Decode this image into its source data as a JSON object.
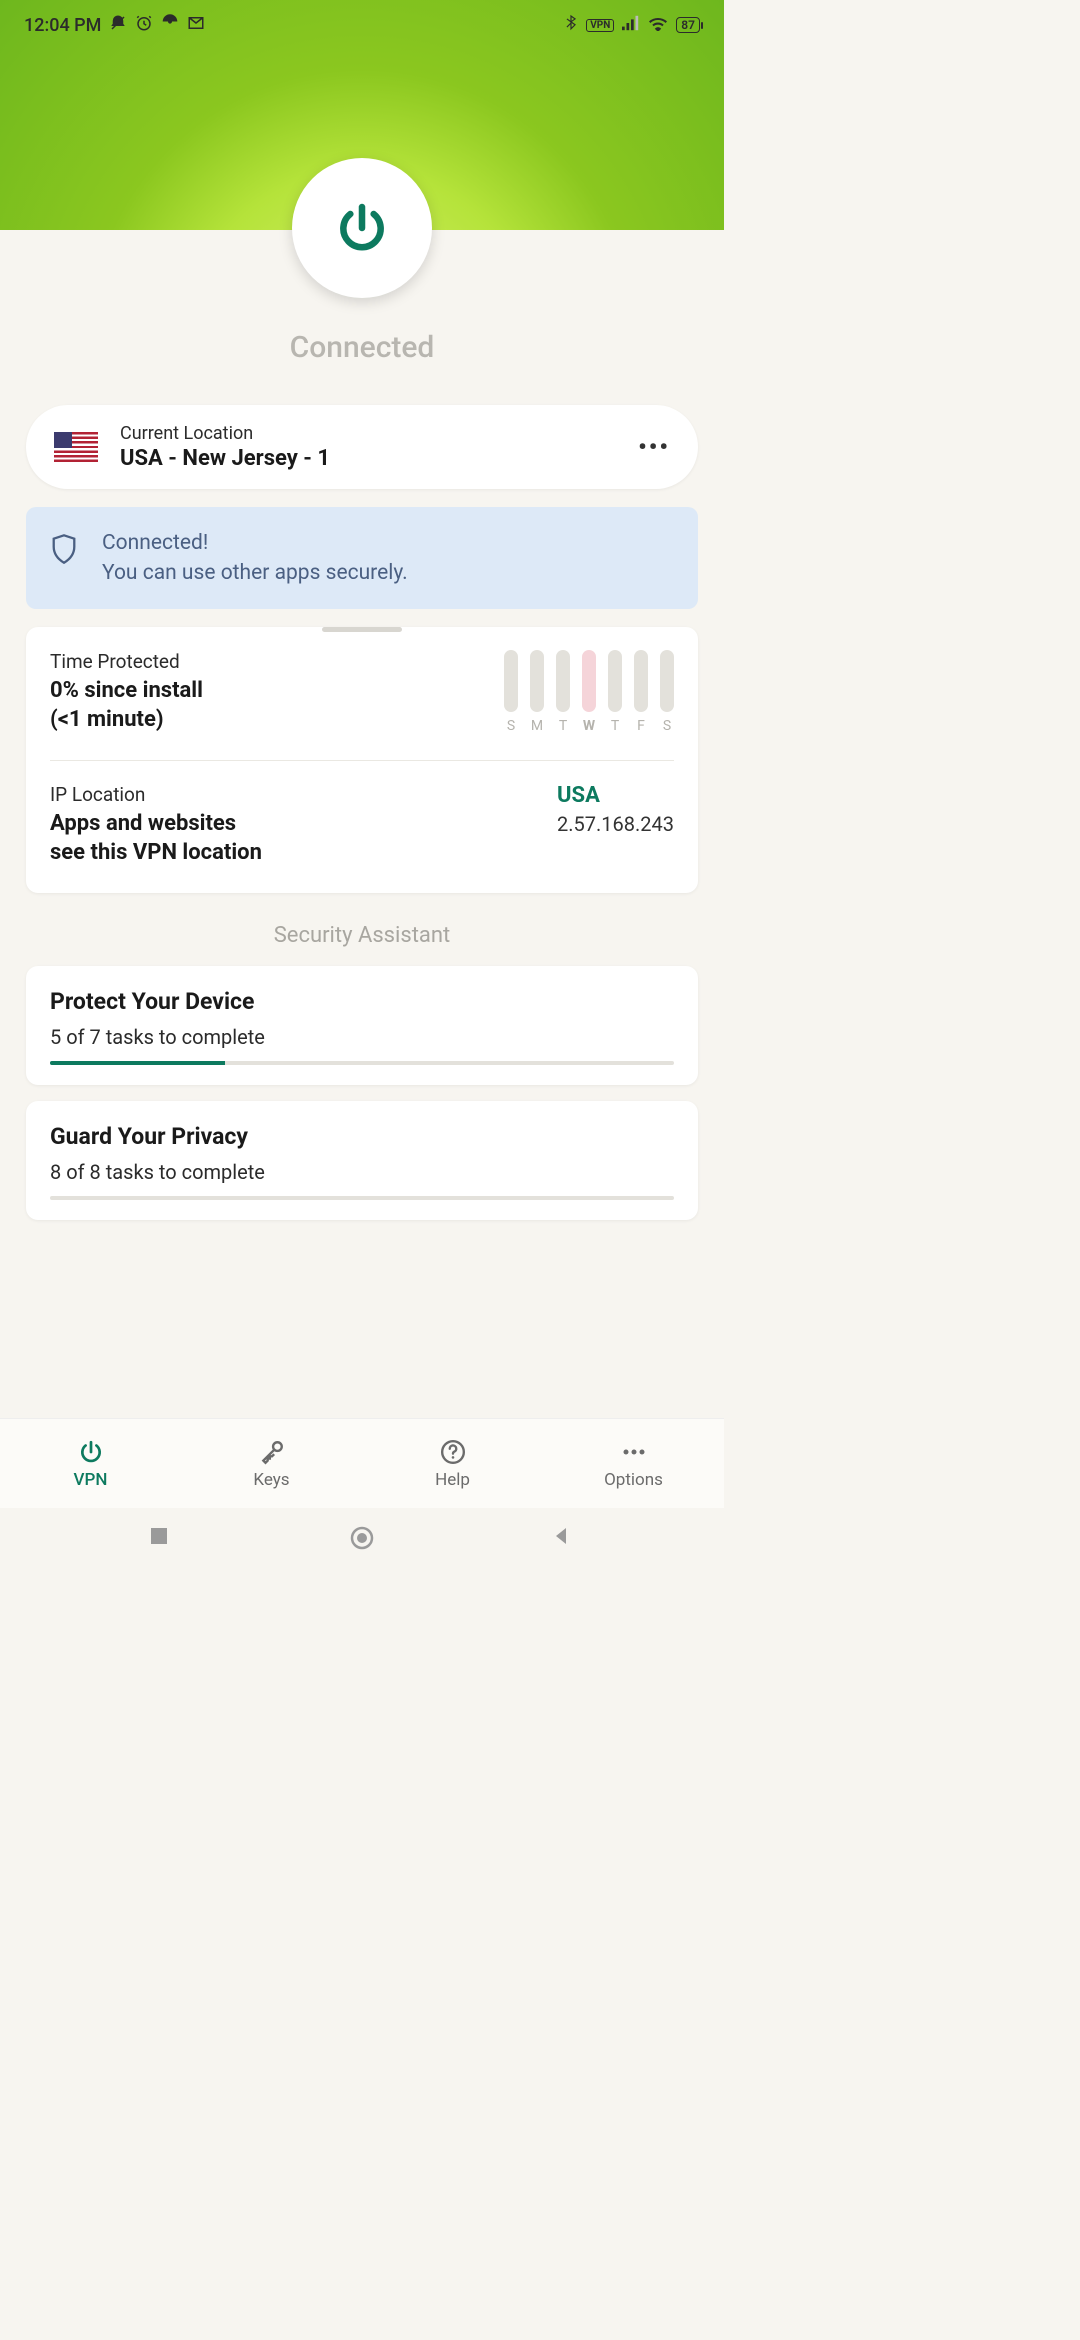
{
  "status_bar": {
    "time": "12:04 PM",
    "battery": "87",
    "vpn_label": "VPN"
  },
  "connection": {
    "status_label": "Connected"
  },
  "location": {
    "label": "Current Location",
    "value": "USA - New Jersey - 1"
  },
  "banner": {
    "title": "Connected!",
    "subtitle": "You can use other apps securely."
  },
  "stats": {
    "time_protected_label": "Time Protected",
    "time_protected_value_line1": "0% since install",
    "time_protected_value_line2": "(<1 minute)",
    "days": [
      "S",
      "M",
      "T",
      "W",
      "T",
      "F",
      "S"
    ],
    "today_index": 3,
    "ip_label": "IP Location",
    "ip_desc_line1": "Apps and websites",
    "ip_desc_line2": "see this VPN location",
    "ip_country": "USA",
    "ip_address": "2.57.168.243"
  },
  "security_assistant": {
    "heading": "Security Assistant",
    "cards": [
      {
        "title": "Protect Your Device",
        "subtitle": "5 of 7 tasks to complete",
        "progress_pct": 28
      },
      {
        "title": "Guard Your Privacy",
        "subtitle": "8 of 8 tasks to complete",
        "progress_pct": 0
      }
    ]
  },
  "nav": {
    "items": [
      {
        "label": "VPN",
        "icon": "power"
      },
      {
        "label": "Keys",
        "icon": "key"
      },
      {
        "label": "Help",
        "icon": "help"
      },
      {
        "label": "Options",
        "icon": "dots"
      }
    ],
    "active_index": 0
  },
  "chart_data": {
    "type": "bar",
    "categories": [
      "S",
      "M",
      "T",
      "W",
      "T",
      "F",
      "S"
    ],
    "values": [
      0,
      0,
      0,
      0,
      0,
      0,
      0
    ],
    "title": "Time Protected",
    "xlabel": "",
    "ylabel": "",
    "ylim": [
      0,
      100
    ]
  }
}
